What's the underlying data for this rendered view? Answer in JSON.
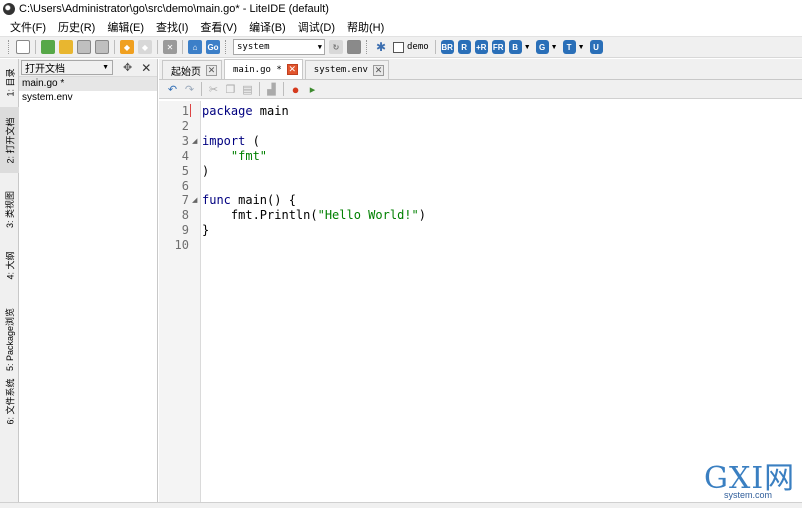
{
  "window": {
    "title": "C:\\Users\\Administrator\\go\\src\\demo\\main.go* - LiteIDE (default)"
  },
  "menu": [
    {
      "label": "文件(F)"
    },
    {
      "label": "历史(R)"
    },
    {
      "label": "编辑(E)"
    },
    {
      "label": "查找(I)"
    },
    {
      "label": "查看(V)"
    },
    {
      "label": "编译(B)"
    },
    {
      "label": "调试(D)"
    },
    {
      "label": "帮助(H)"
    }
  ],
  "toolbar": {
    "env_combo": "system",
    "demo_checkbox": "demo",
    "build_buttons": [
      "BR",
      "R",
      "+R",
      "FR",
      "B",
      "G",
      "T",
      "U"
    ]
  },
  "side_tabs": [
    {
      "label": "1: 目录"
    },
    {
      "label": "2: 打开文档"
    },
    {
      "label": "3: 类视图"
    },
    {
      "label": "4: 大纲"
    },
    {
      "label": "5: Package浏览"
    },
    {
      "label": "6: 文件系统"
    }
  ],
  "left_panel": {
    "combo": "打开文档",
    "files": [
      {
        "name": "main.go *"
      },
      {
        "name": "system.env"
      }
    ]
  },
  "editor_tabs": [
    {
      "label": "起始页"
    },
    {
      "label": "main.go *"
    },
    {
      "label": "system.env"
    }
  ],
  "code": [
    {
      "n": "1",
      "text": "package main"
    },
    {
      "n": "2",
      "text": ""
    },
    {
      "n": "3",
      "text": "import ("
    },
    {
      "n": "4",
      "text": "    \"fmt\""
    },
    {
      "n": "5",
      "text": ")"
    },
    {
      "n": "6",
      "text": ""
    },
    {
      "n": "7",
      "text": "func main() {"
    },
    {
      "n": "8",
      "text": "    fmt.Println(\"Hello World!\")"
    },
    {
      "n": "9",
      "text": "}"
    },
    {
      "n": "10",
      "text": ""
    }
  ],
  "watermark": {
    "brand": "GXI网",
    "domain": "system.com"
  },
  "colors": {
    "keyword": "#000080",
    "string": "#008000",
    "current_line": "#dde9e6"
  }
}
